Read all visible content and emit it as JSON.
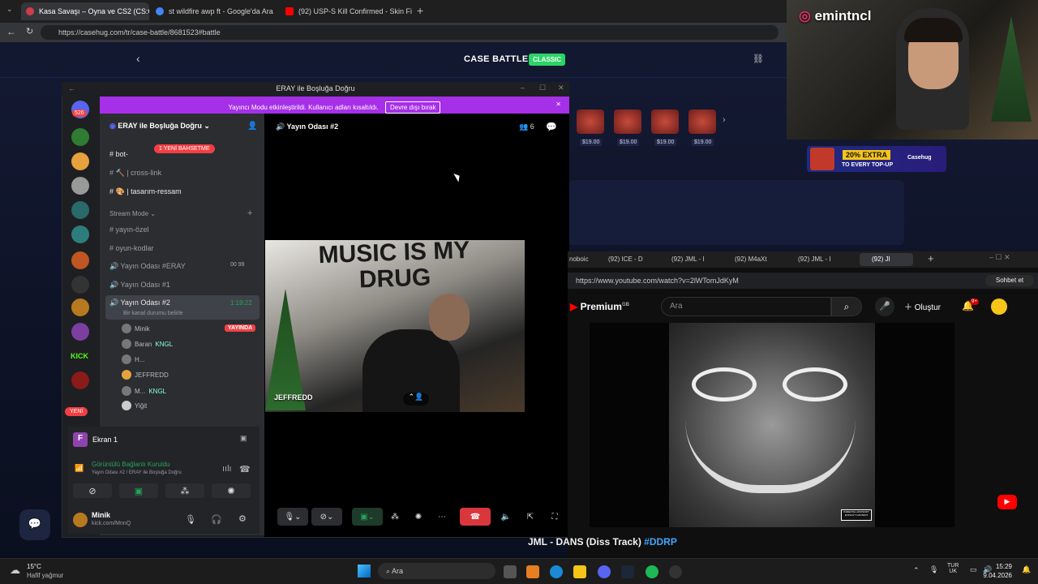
{
  "browser": {
    "tabs": [
      {
        "label": "Kasa Savaşı – Oyna ve CS2 (CS:GO)",
        "active": true
      },
      {
        "label": "st wildfire awp ft - Google'da Ara",
        "active": false
      },
      {
        "label": "(92) USP-S Kill Confirmed - Skin Fi",
        "active": false
      }
    ],
    "url": "https://casehug.com/tr/case-battle/8681523#battle"
  },
  "casehug": {
    "title": "CASE BATTLE",
    "mode_badge": "CLASSIC",
    "case_prices": [
      "$19.00",
      "$19.00",
      "$19.00",
      "$19.00"
    ],
    "promo_line1": "20% EXTRA",
    "promo_line2": "TO EVERY TOP-UP",
    "promo_brand": "Casehug"
  },
  "webcam": {
    "streamer": "emintncl"
  },
  "discord": {
    "window_title": "ERAY ile Boşluğa Doğru",
    "stream_banner": "Yayıncı Modu etkinleştirildi. Kullanıcı adları kısaltıldı.",
    "stream_banner_button": "Devre dışı bırak",
    "server_name": "ERAY ile Boşluğa Doğru",
    "unread_badge": "526",
    "new_badge": "YENİ",
    "new_mentions_pill": "1 YENİ BAHSETME",
    "channels_top": [
      "bot-",
      "cross-link",
      "tasarım-ressam"
    ],
    "category": "Stream Mode",
    "channels": [
      "yayın-özel",
      "oyun-kodlar",
      "Yayın Odası #ERAY",
      "Yayın Odası #1",
      "Yayın Odası #2"
    ],
    "eray_counts": [
      "00",
      "99"
    ],
    "active_channel_time": "1:19:22",
    "active_channel_status": "Bir kanal durumu belirle",
    "members": [
      {
        "name": "Minik",
        "badge": "YAYINDA"
      },
      {
        "name": "Baran",
        "tag": "KNGL"
      },
      {
        "name": "H..."
      },
      {
        "name": "JEFFREDD"
      },
      {
        "name": "M...",
        "tag": "KNGL"
      },
      {
        "name": "Yiğit"
      }
    ],
    "screen_share_label": "Ekran 1",
    "connection_status": "Görüntülü Bağlantı Kuruldu",
    "connection_channel": "Yayın Odası #2 / ERAY ile Boşluğa Doğru",
    "user_name": "Minik",
    "user_status": "kick.com/MnnQ",
    "voice_channel_title": "Yayın Odası #2",
    "voice_count": "6",
    "video_user": "JEFFREDD",
    "video_text": "MUSIC IS MY DRUG"
  },
  "youtube": {
    "tabs": [
      "noboic",
      "(92) ICE - D",
      "(92) JML - I",
      "(92) M4aXt",
      "(92) JML - I",
      "(92) JI"
    ],
    "url": "https://www.youtube.com/watch?v=2lWTomJdKyM",
    "logo": "Premium",
    "logo_region": "GB",
    "search_placeholder": "Ara",
    "create_label": "Oluştur",
    "notif_count": "9+",
    "chat_label": "Sohbet et",
    "video_title": "JML - DANS (Diss Track)",
    "video_hashtag": "#DDRP",
    "cover_sticker": "PARENTAL ADVISORY EXPLICIT CONTENT"
  },
  "taskbar": {
    "weather_temp": "15°C",
    "weather_desc": "Hafif yağmur",
    "search_label": "Ara",
    "lang_top": "TUR",
    "lang_bottom": "UK",
    "time": "15:29",
    "date": "9.04.2026"
  }
}
